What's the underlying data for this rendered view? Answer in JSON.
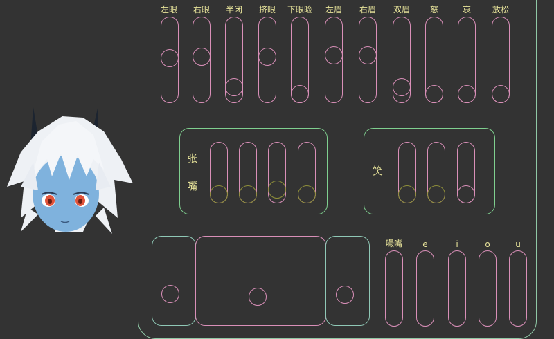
{
  "top_labels": [
    "左眼",
    "右眼",
    "半闭",
    "挤眼",
    "下眼睑",
    "左眉",
    "右眉",
    "双眉",
    "怒",
    "哀",
    "放松"
  ],
  "mouth_open_label_line1": "张",
  "mouth_open_label_line2": "嘴",
  "smile_label": "笑",
  "pout_label": "嘬嘴",
  "vowels": [
    "e",
    "i",
    "o",
    "u"
  ],
  "avatar": {
    "skin_color": "#7fb2dd",
    "hair_color": "#f2f4f7",
    "eye_color": "#e0533a",
    "horn_color": "#1c2430"
  },
  "colors": {
    "background": "#333333",
    "label": "#e7e39a",
    "slider_track": "#d98fb8",
    "group_border": "#7fcf8f",
    "outer_border": "#8fc8a6"
  }
}
